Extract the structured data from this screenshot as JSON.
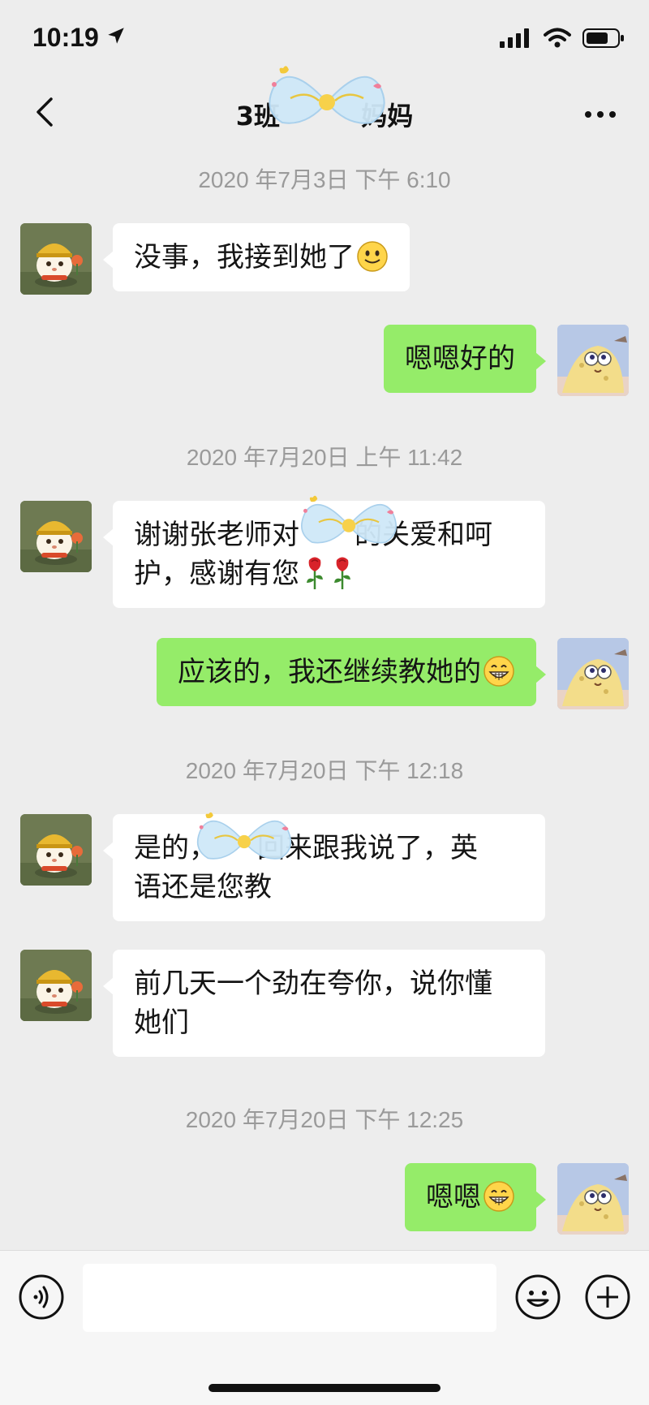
{
  "status_bar": {
    "time": "10:19",
    "icons": [
      "location-arrow-icon",
      "signal-icon",
      "wifi-icon",
      "battery-icon"
    ]
  },
  "header": {
    "title": "3班         妈妈",
    "back_icon": "chevron-left-icon",
    "more_icon": "more-dots-icon"
  },
  "chat": {
    "timestamps": [
      "2020 年7月3日  下午 6:10",
      "2020 年7月20日  上午 11:42",
      "2020 年7月20日  下午 12:18",
      "2020 年7月20日  下午 12:25"
    ],
    "messages": [
      {
        "side": "left",
        "text": "没事，我接到她了"
      },
      {
        "side": "right",
        "text": "嗯嗯好的"
      },
      {
        "side": "left",
        "text_line1": "谢谢张老师对",
        "text_line1b": "的关爱和呵",
        "text_line2": "护，感谢有您"
      },
      {
        "side": "right",
        "text": "应该的，我还继续教她的"
      },
      {
        "side": "left",
        "text_line1": "是的，",
        "text_line1b": "回来跟我说了，英",
        "text_line2": "语还是您教"
      },
      {
        "side": "left",
        "text_line1": "前几天一个劲在夸你，说你懂",
        "text_line2": "她们"
      },
      {
        "side": "right",
        "text": "嗯嗯"
      }
    ]
  },
  "input_bar": {
    "placeholder": "",
    "voice_icon": "voice-icon",
    "emoji_icon": "emoji-icon",
    "plus_icon": "plus-icon"
  },
  "colors": {
    "background": "#ededed",
    "bubble_self": "#95ec69",
    "bubble_other": "#ffffff",
    "timestamp": "#9a9a9a"
  }
}
